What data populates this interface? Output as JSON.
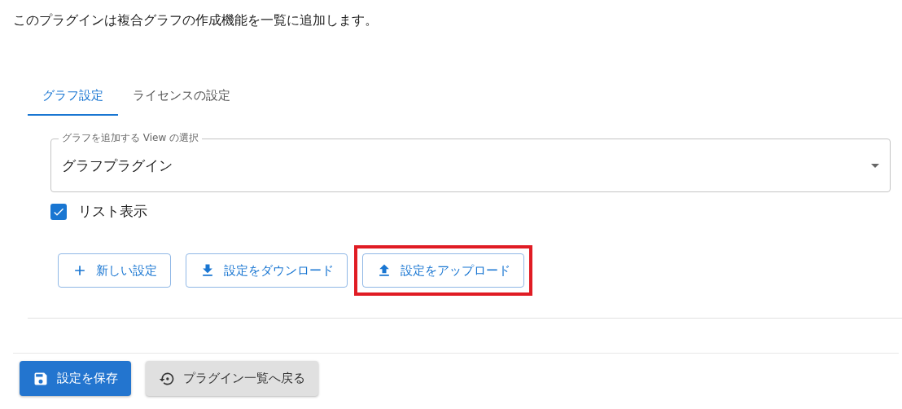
{
  "description": "このプラグインは複合グラフの作成機能を一覧に追加します。",
  "tabs": [
    {
      "label": "グラフ設定",
      "selected": true
    },
    {
      "label": "ライセンスの設定",
      "selected": false
    }
  ],
  "view_select": {
    "label": "グラフを追加する View の選択",
    "value": "グラフプラグイン"
  },
  "list_display": {
    "label": "リスト表示",
    "checked": true
  },
  "actions": [
    {
      "kind": "new",
      "label": "新しい設定",
      "highlighted": false
    },
    {
      "kind": "download",
      "label": "設定をダウンロード",
      "highlighted": false
    },
    {
      "kind": "upload",
      "label": "設定をアップロード",
      "highlighted": true
    }
  ],
  "footer_buttons": [
    {
      "kind": "save",
      "label": "設定を保存"
    },
    {
      "kind": "back",
      "label": "プラグイン一覧へ戻る"
    }
  ]
}
